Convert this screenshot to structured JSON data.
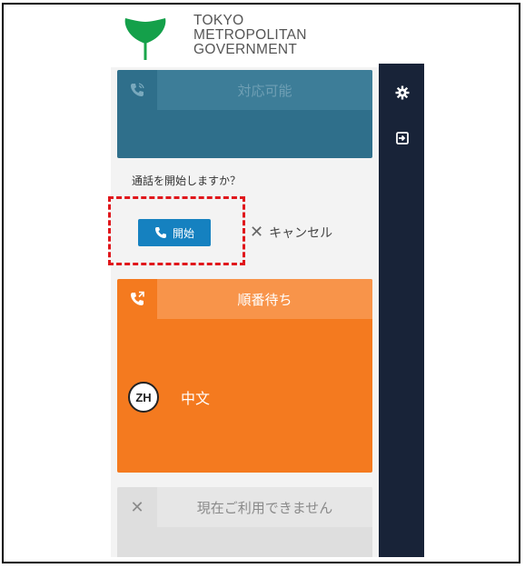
{
  "header": {
    "logo_icon": "tokyo-ginkgo-logo",
    "logo_lines": [
      "TOKYO",
      "METROPOLITAN",
      "GOVERNMENT"
    ]
  },
  "sidebar": {
    "items": [
      {
        "icon": "gear-icon"
      },
      {
        "icon": "sign-in-icon"
      }
    ]
  },
  "cards": {
    "available": {
      "icon": "phone-volume-icon",
      "title": "対応可能"
    },
    "queue": {
      "icon": "phone-forward-icon",
      "title": "順番待ち",
      "language": {
        "code": "ZH",
        "name": "中文"
      }
    },
    "unavailable": {
      "icon": "close-icon",
      "title": "現在ご利用できません"
    }
  },
  "call_prompt": {
    "question": "通話を開始しますか？",
    "start_label": "開始",
    "cancel_label": "キャンセル"
  },
  "colors": {
    "available": "#2f6f8b",
    "queue": "#f47a1f",
    "start_button": "#1581c0",
    "sidebar": "#182338",
    "highlight": "#e0161b"
  }
}
